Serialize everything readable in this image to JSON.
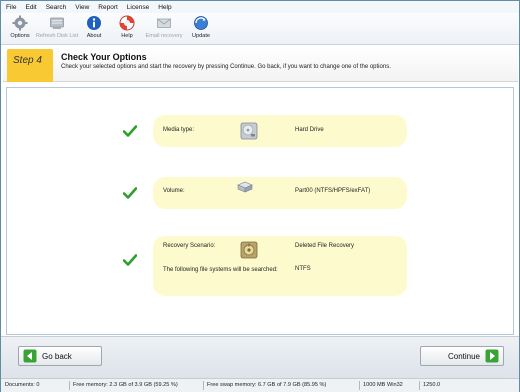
{
  "menu": [
    "File",
    "Edit",
    "Search",
    "View",
    "Report",
    "License",
    "Help"
  ],
  "toolbar": [
    {
      "label": "Options",
      "icon": "gear-icon",
      "enabled": true
    },
    {
      "label": "Refresh Disk List",
      "icon": "disk-list-icon",
      "enabled": false
    },
    {
      "label": "About",
      "icon": "info-icon",
      "enabled": true
    },
    {
      "label": "Help",
      "icon": "lifebuoy-icon",
      "enabled": true
    },
    {
      "label": "Email recovery",
      "icon": "envelope-icon",
      "enabled": false
    },
    {
      "label": "Update",
      "icon": "update-globe-icon",
      "enabled": true
    }
  ],
  "header": {
    "step": "Step 4",
    "title": "Check Your Options",
    "subtitle": "Check your selected options and start the recovery by pressing Continue. Go back, if you want to change one of the options."
  },
  "options": [
    {
      "label": "Media type:",
      "icon": "hard-drive-icon",
      "value": "Hard Drive"
    },
    {
      "label": "Volume:",
      "icon": "volume-icon",
      "value": "Part00 (NTFS/HPFS/exFAT)"
    },
    {
      "label": "Recovery Scenario:",
      "icon": "recovery-icon",
      "value": "Deleted File Recovery",
      "label2": "The following file systems will be searched:",
      "value2": "NTFS"
    }
  ],
  "buttons": {
    "back": "Go back",
    "continue": "Continue"
  },
  "status": {
    "documents": "Documents: 0",
    "free_memory": "Free memory: 2.3 GB of 3.9 GB (59.25 %)",
    "free_swap": "Free swap memory: 6.7 GB of 7.9 GB (85.95 %)",
    "version": "1000 MB Win32",
    "build": "1250.0"
  },
  "colors": {
    "accent": "#f9c933",
    "panel": "#fdfbcd",
    "check": "#2ea02a"
  }
}
